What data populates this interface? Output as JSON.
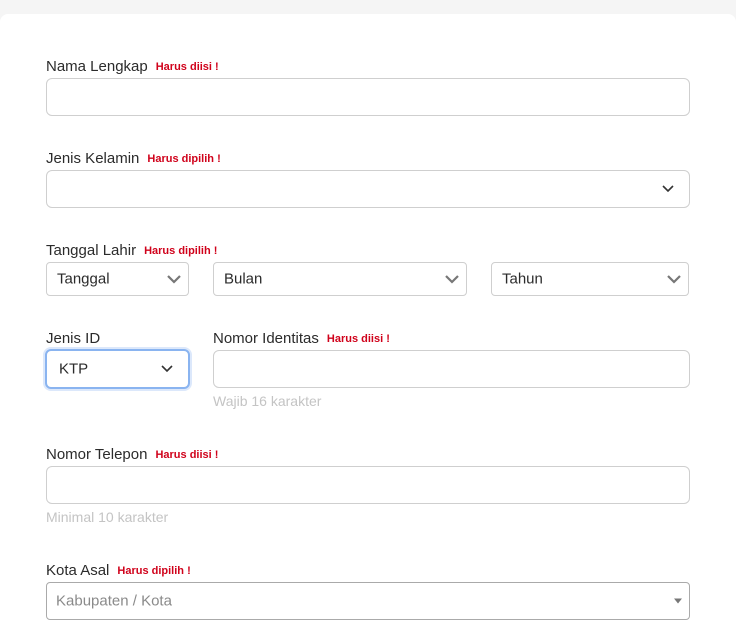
{
  "form": {
    "full_name": {
      "label": "Nama Lengkap",
      "error": "Harus diisi !",
      "value": ""
    },
    "gender": {
      "label": "Jenis Kelamin",
      "error": "Harus dipilih !",
      "value": ""
    },
    "birth_date": {
      "label": "Tanggal Lahir",
      "error": "Harus dipilih !",
      "day_value": "Tanggal",
      "month_value": "Bulan",
      "year_value": "Tahun"
    },
    "id_type": {
      "label": "Jenis ID",
      "value": "KTP"
    },
    "id_number": {
      "label": "Nomor Identitas",
      "error": "Harus diisi !",
      "value": "",
      "hint": "Wajib 16 karakter"
    },
    "phone": {
      "label": "Nomor Telepon",
      "error": "Harus diisi !",
      "value": "",
      "hint": "Minimal 10 karakter"
    },
    "city": {
      "label": "Kota Asal",
      "error": "Harus dipilih !",
      "placeholder": "Kabupaten / Kota"
    }
  },
  "colors": {
    "error": "#d0021b",
    "border": "#cfcfcf",
    "focus": "#8ab4f0",
    "hint": "#c4c4c4"
  },
  "icons": {
    "select_chevron": "chevron-down-icon",
    "city_caret": "caret-down-icon"
  }
}
